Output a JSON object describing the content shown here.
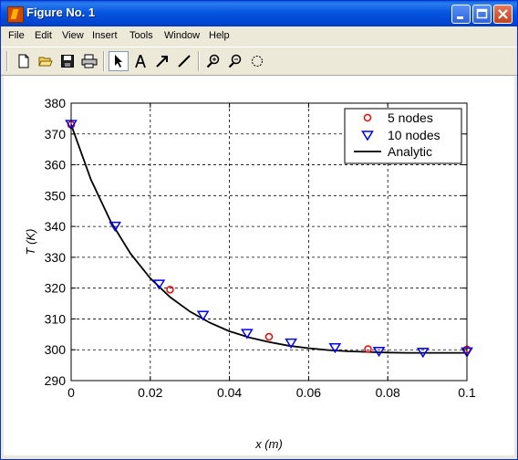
{
  "window": {
    "title": "Figure No. 1"
  },
  "menu": [
    "File",
    "Edit",
    "View",
    "Insert",
    "Tools",
    "Window",
    "Help"
  ],
  "toolbar": {
    "tools": [
      "new-file-icon",
      "open-folder-icon",
      "save-icon",
      "print-icon",
      "edit-plot-arrow-icon",
      "insert-text-icon",
      "insert-arrow-icon",
      "insert-line-icon",
      "zoom-in-icon",
      "zoom-out-icon",
      "rotate-3d-icon"
    ]
  },
  "chart_data": {
    "type": "line",
    "xlabel": "x (m)",
    "ylabel": "T (K)",
    "xlim": [
      0,
      0.1
    ],
    "ylim": [
      290,
      380
    ],
    "xticks": [
      "0",
      "0.02",
      "0.04",
      "0.06",
      "0.08",
      "0.1"
    ],
    "yticks": [
      "290",
      "300",
      "310",
      "320",
      "330",
      "340",
      "350",
      "360",
      "370",
      "380"
    ],
    "grid": true,
    "legend_position": "top-right",
    "series": [
      {
        "name": "5 nodes",
        "marker": "circle",
        "color": "#ff0000",
        "x": [
          0,
          0.025,
          0.05,
          0.075,
          0.1
        ],
        "y": [
          373,
          319.5,
          304.2,
          300.2,
          300.1
        ]
      },
      {
        "name": "10 nodes",
        "marker": "triangle-down",
        "color": "#0000ff",
        "x": [
          0,
          0.01111,
          0.02222,
          0.03333,
          0.04444,
          0.05556,
          0.06667,
          0.07778,
          0.08889,
          0.1
        ],
        "y": [
          373,
          340,
          321.2,
          311.1,
          305.2,
          302.1,
          300.6,
          299.4,
          299.1,
          299.2
        ]
      },
      {
        "name": "Analytic",
        "marker": "none",
        "color": "#000000",
        "x": [
          0,
          0.005,
          0.01,
          0.015,
          0.02,
          0.025,
          0.03,
          0.035,
          0.04,
          0.045,
          0.05,
          0.055,
          0.06,
          0.065,
          0.07,
          0.075,
          0.08,
          0.085,
          0.09,
          0.095,
          0.1
        ],
        "y": [
          373,
          355.2,
          341.6,
          331.2,
          323.2,
          317.1,
          312.4,
          308.8,
          306.0,
          304.0,
          302.5,
          301.3,
          300.5,
          299.9,
          299.5,
          299.3,
          299.1,
          299.0,
          299.0,
          299.0,
          299.0
        ]
      }
    ]
  }
}
